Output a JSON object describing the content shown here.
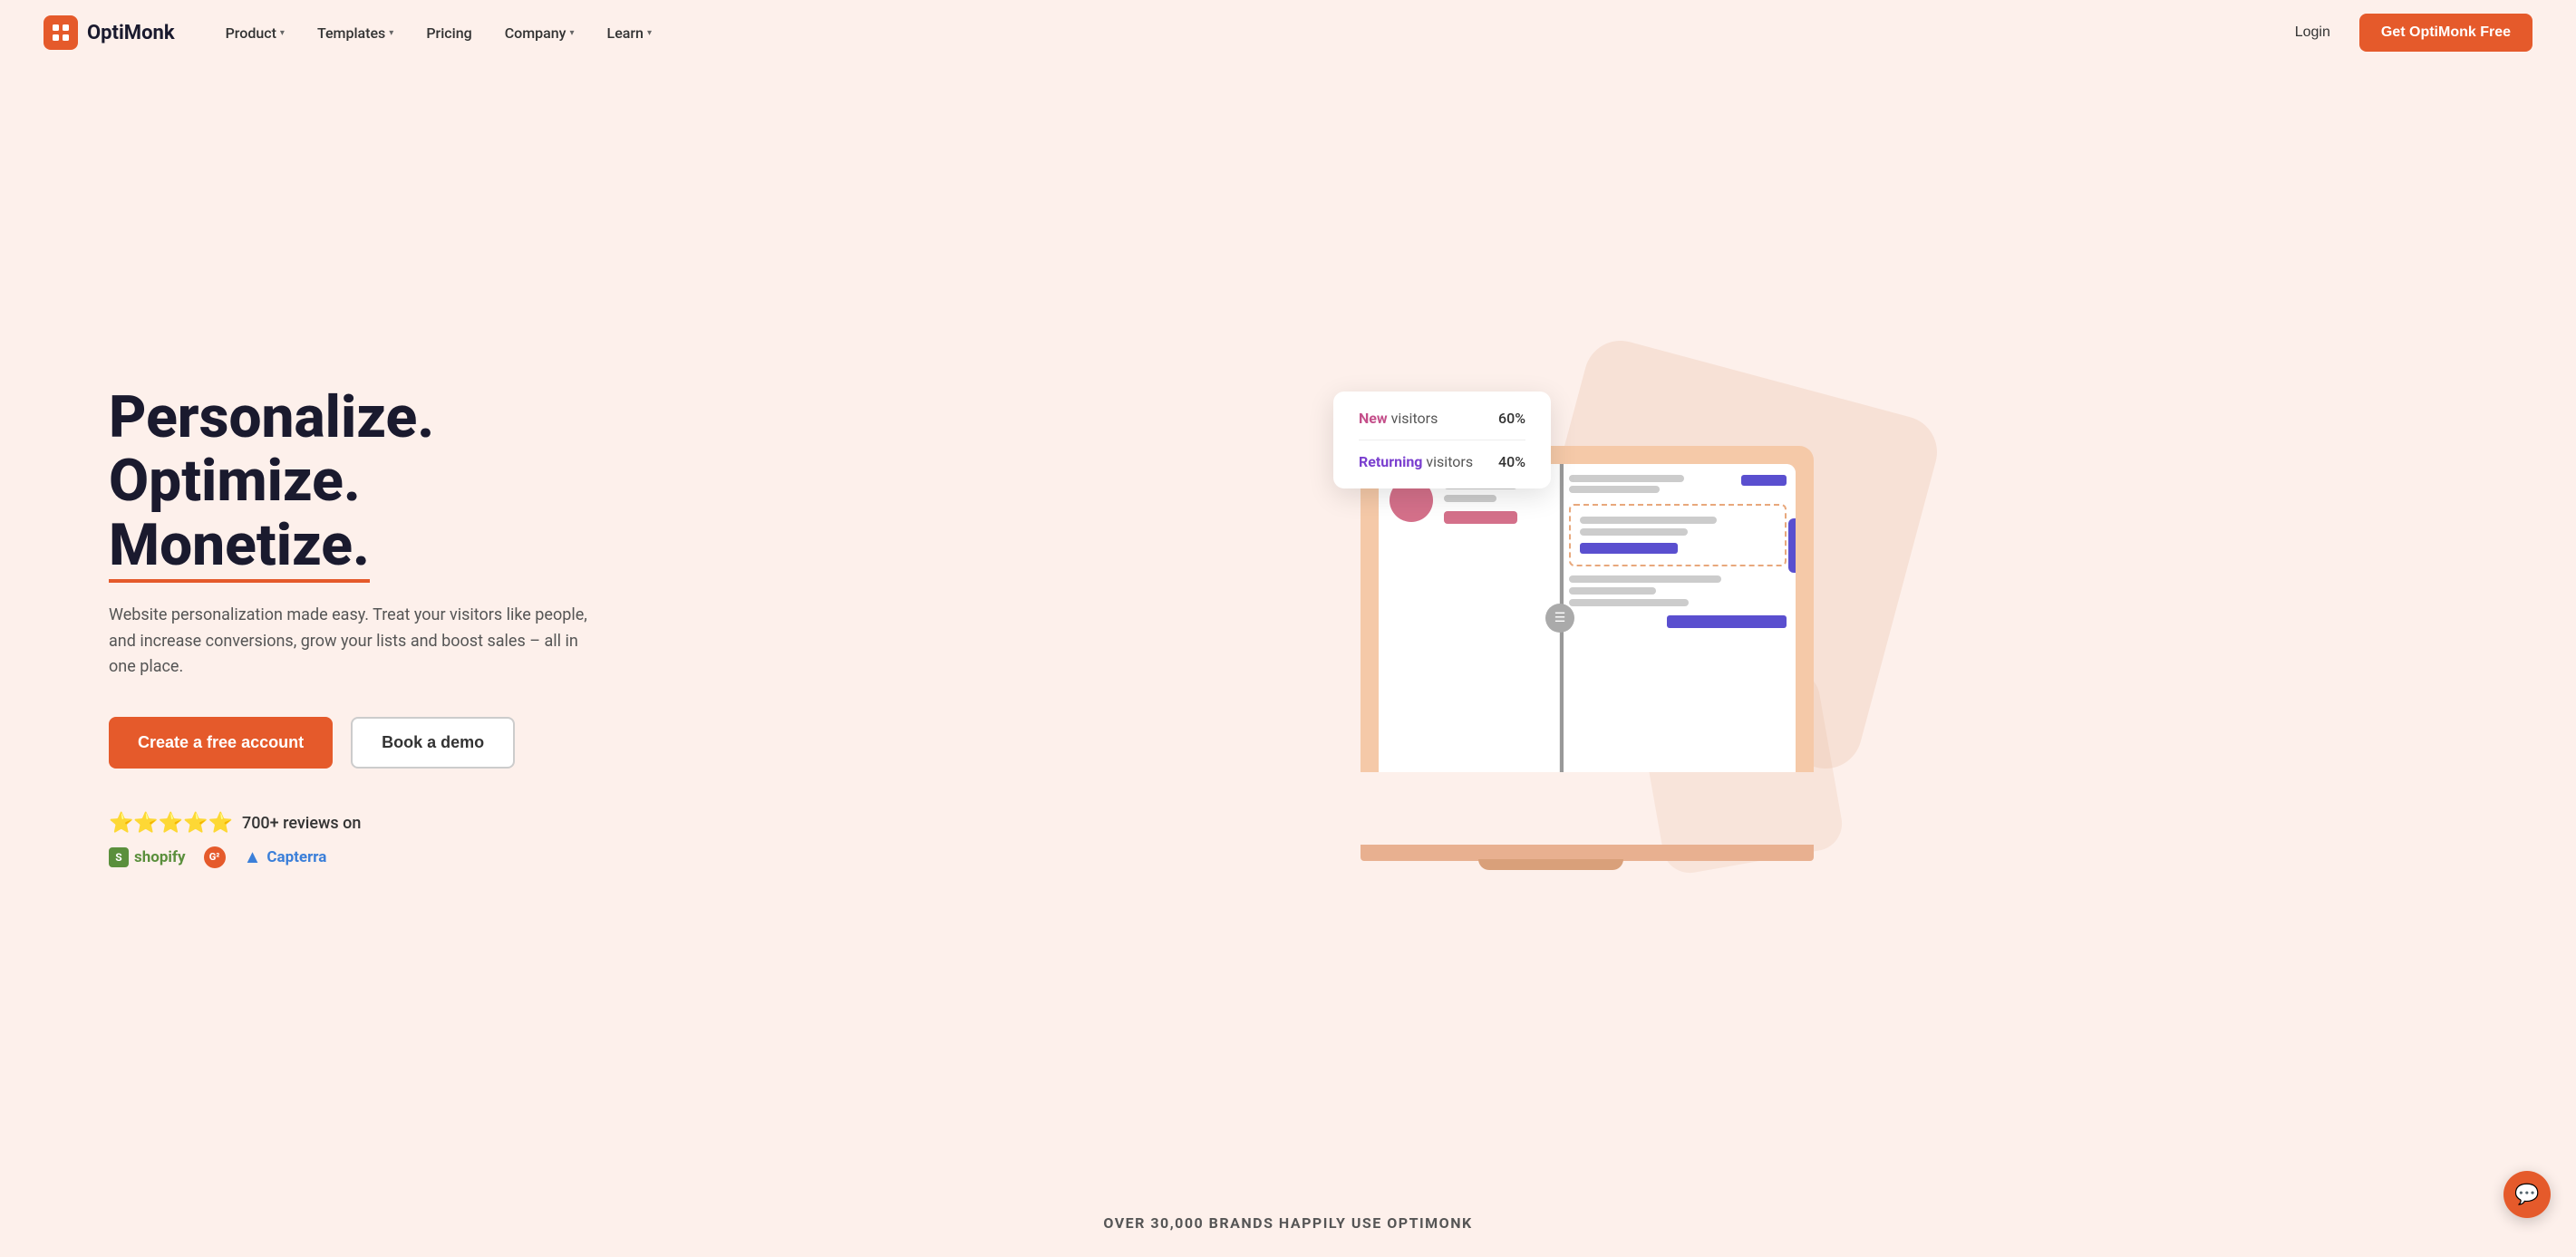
{
  "brand": {
    "name": "OptiMonk",
    "logo_alt": "OptiMonk logo"
  },
  "nav": {
    "items": [
      {
        "label": "Product",
        "has_dropdown": true
      },
      {
        "label": "Templates",
        "has_dropdown": true
      },
      {
        "label": "Pricing",
        "has_dropdown": false
      },
      {
        "label": "Company",
        "has_dropdown": true
      },
      {
        "label": "Learn",
        "has_dropdown": true
      }
    ],
    "login_label": "Login",
    "cta_label": "Get OptiMonk Free"
  },
  "hero": {
    "title_line1": "Personalize. Optimize.",
    "title_line2": "Monetize.",
    "subtitle": "Website personalization made easy. Treat your visitors like people, and increase conversions, grow your lists and boost sales – all in one place.",
    "cta_primary": "Create a free account",
    "cta_secondary": "Book a demo",
    "stars": "⭐⭐⭐⭐⭐",
    "review_text": "700+ reviews on",
    "platforms": [
      {
        "name": "Shopify",
        "icon": "S"
      },
      {
        "name": "G2",
        "icon": "G²"
      },
      {
        "name": "Capterra",
        "icon": "▲"
      }
    ]
  },
  "stats_card": {
    "new_label": "New",
    "visitors_label": "visitors",
    "new_value": "60%",
    "returning_label": "Returning",
    "returning_value": "40%"
  },
  "bottom_bar": {
    "text": "OVER 30,000 BRANDS HAPPILY USE OPTIMONK"
  },
  "chat": {
    "icon": "💬"
  },
  "colors": {
    "brand_orange": "#e55a2b",
    "bg": "#fdf0eb",
    "purple": "#5a4fcf",
    "pink": "#d4708a"
  }
}
